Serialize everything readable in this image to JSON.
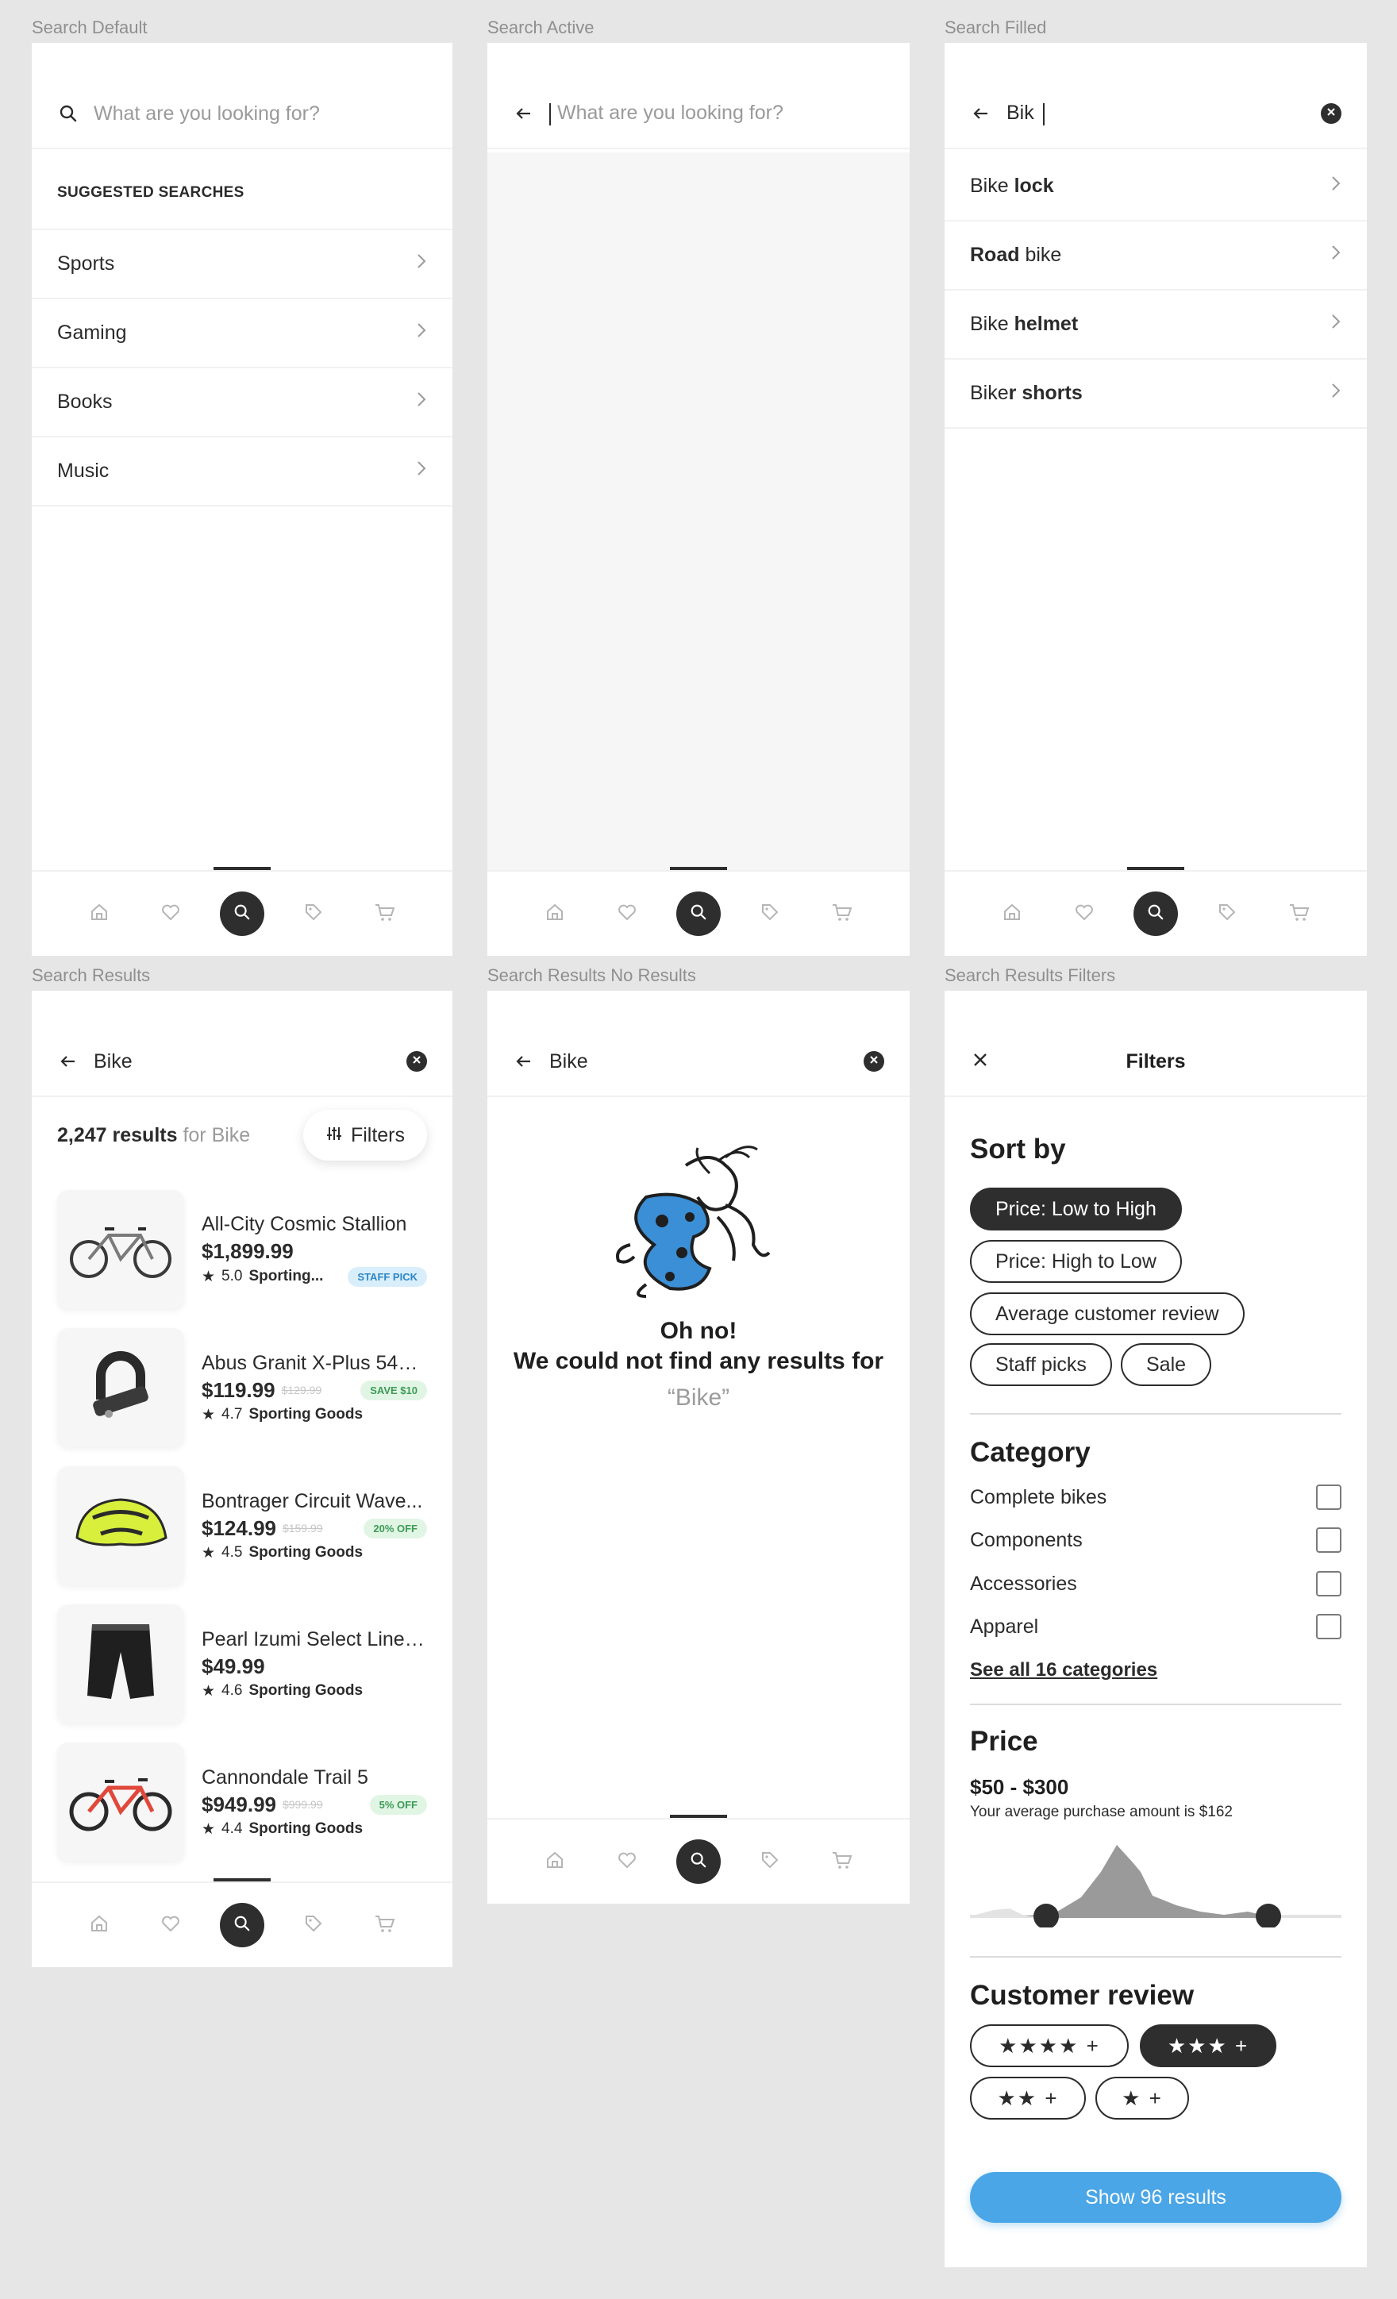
{
  "frames": {
    "search_default": {
      "label": "Search Default",
      "placeholder": "What are you looking for?",
      "section_title": "SUGGESTED SEARCHES",
      "suggestions": [
        "Sports",
        "Gaming",
        "Books",
        "Music"
      ]
    },
    "search_active": {
      "label": "Search Active",
      "placeholder": "What are you looking for?"
    },
    "search_filled": {
      "label": "Search Filled",
      "query": "Bik",
      "suggestions": [
        {
          "typed": "Bike",
          "completion": " lock"
        },
        {
          "typed": "Road",
          "completion": " bike"
        },
        {
          "typed": "Bike",
          "completion": " helmet"
        },
        {
          "typed": "Bike",
          "completion": "r shorts"
        }
      ]
    },
    "search_results": {
      "label": "Search Results",
      "query": "Bike",
      "count": "2,247 results",
      "for_text": "for Bike",
      "filters_label": "Filters",
      "products": [
        {
          "name": "All-City Cosmic Stallion",
          "price": "$1,899.99",
          "old_price": "",
          "rating": "5.0",
          "source": "Sporting...",
          "badge": "STAFF PICK",
          "badge_color": "#2c86c6"
        },
        {
          "name": "Abus Granit X-Plus 540 ...",
          "price": "$119.99",
          "old_price": "$129.99",
          "rating": "4.7",
          "source": "Sporting Goods",
          "badge": "SAVE $10",
          "badge_color": "#3d9b56"
        },
        {
          "name": "Bontrager Circuit Wave...",
          "price": "$124.99",
          "old_price": "$159.99",
          "rating": "4.5",
          "source": "Sporting Goods",
          "badge": "20% OFF",
          "badge_color": "#3d9b56"
        },
        {
          "name": "Pearl Izumi Select Liner ...",
          "price": "$49.99",
          "old_price": "",
          "rating": "4.6",
          "source": "Sporting Goods",
          "badge": "",
          "badge_color": ""
        },
        {
          "name": "Cannondale Trail 5",
          "price": "$949.99",
          "old_price": "$999.99",
          "rating": "4.4",
          "source": "Sporting Goods",
          "badge": "5% OFF",
          "badge_color": "#3d9b56"
        }
      ]
    },
    "no_results": {
      "label": "Search Results No Results",
      "query": "Bike",
      "line1": "Oh no!",
      "line2": "We could not find any results for",
      "quoted": "“Bike”"
    },
    "filters": {
      "label": "Search Results Filters",
      "title": "Filters",
      "sort_title": "Sort by",
      "sort_options": [
        "Price: Low to High",
        "Price: High to Low",
        "Average customer review",
        "Staff picks",
        "Sale"
      ],
      "sort_selected": "Price: Low to High",
      "category_title": "Category",
      "categories": [
        "Complete bikes",
        "Components",
        "Accessories",
        "Apparel"
      ],
      "see_all": "See all 16 categories",
      "price_title": "Price",
      "price_range": "$50 - $300",
      "price_note": "Your average purchase amount is $162",
      "review_title": "Customer review",
      "review_options": [
        {
          "stars": 4,
          "text": "★★★★ +"
        },
        {
          "stars": 3,
          "text": "★★★ +"
        },
        {
          "stars": 2,
          "text": "★★ +"
        },
        {
          "stars": 1,
          "text": "★ +"
        }
      ],
      "review_selected": 3,
      "show_button": "Show 96 results"
    }
  },
  "nav_icons": [
    "home-icon",
    "heart-icon",
    "search-icon",
    "tag-icon",
    "cart-icon"
  ],
  "colors": {
    "accent": "#4aa6e6",
    "dark": "#2e2e2e",
    "background": "#e6e6e6"
  }
}
